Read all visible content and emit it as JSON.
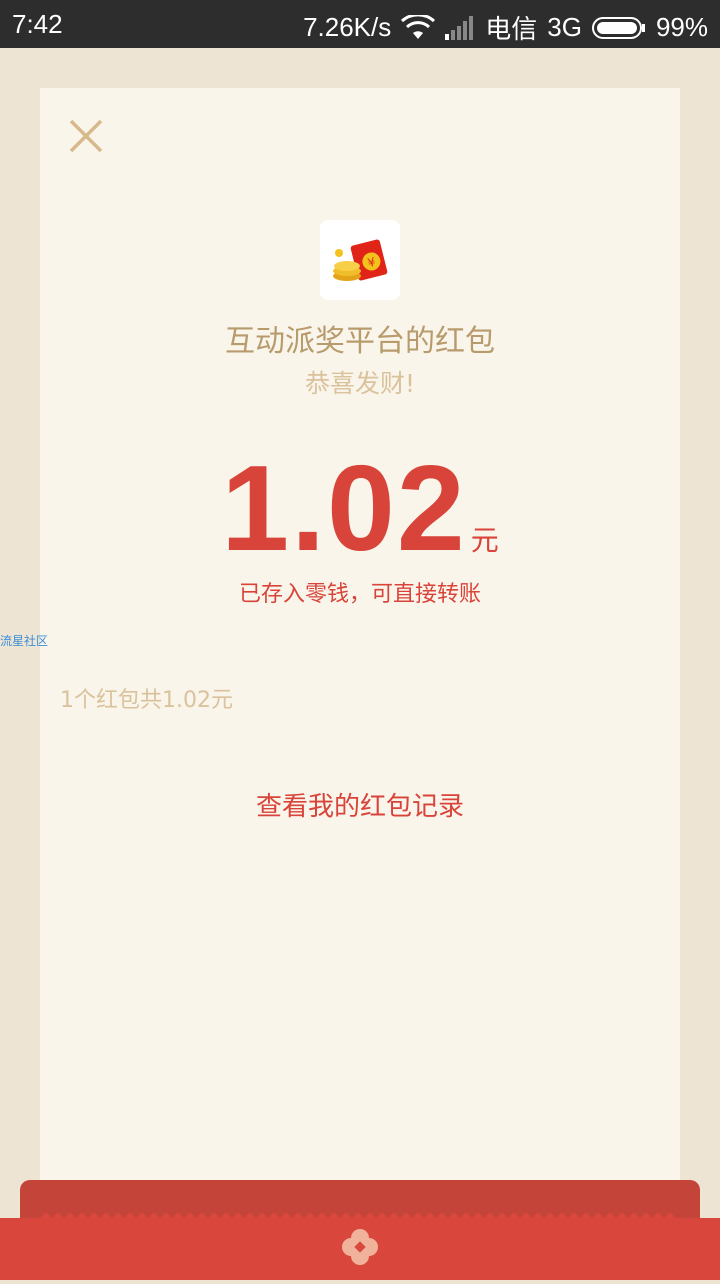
{
  "status_bar": {
    "time": "7:42",
    "network_speed": "7.26K/s",
    "carrier": "电信",
    "network_type": "3G",
    "battery": "99%"
  },
  "card": {
    "close_icon": "close-icon",
    "logo_icon": "red-envelope-coins-icon",
    "sender_title": "互动派奖平台的红包",
    "greeting": "恭喜发财!",
    "amount": "1.02",
    "currency_unit": "元",
    "saved_note": "已存入零钱，可直接转账",
    "summary": "1个红包共1.02元",
    "records_link": "查看我的红包记录"
  },
  "watermark": "流星社区",
  "colors": {
    "accent_red": "#d9443a",
    "gold_text": "#b79b6d",
    "light_gold_text": "#d9c29c",
    "paper": "#faf5ea",
    "background": "#ede4d3"
  }
}
